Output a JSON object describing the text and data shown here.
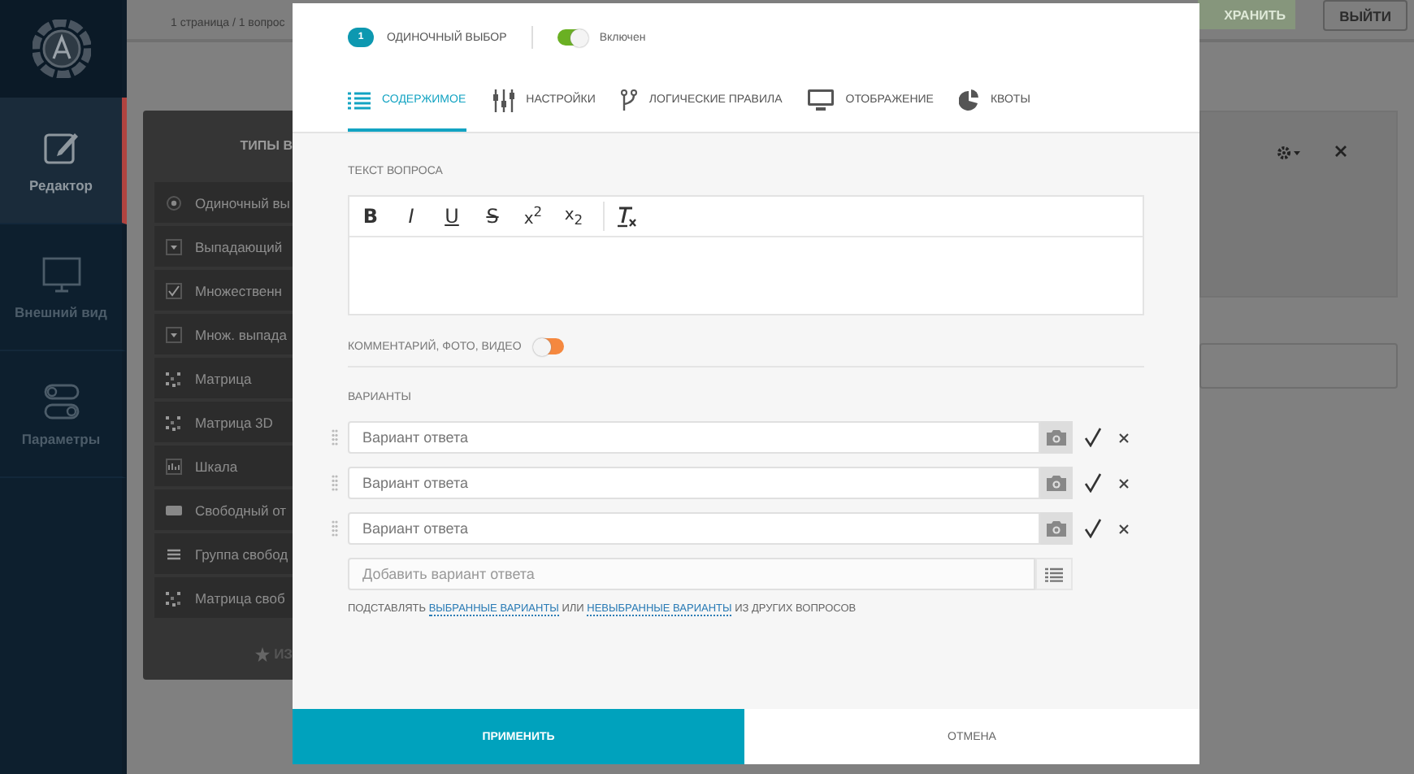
{
  "app_header": {
    "page_count": "1 страница / 1 вопрос",
    "save_button": "ХРАНИТЬ",
    "exit_button": "ВЫЙТИ"
  },
  "sidebar": {
    "items": [
      {
        "label": "Редактор",
        "kind": "edit",
        "selected": true
      },
      {
        "label": "Внешний вид",
        "kind": "monitor",
        "selected": false
      },
      {
        "label": "Параметры",
        "kind": "toggles",
        "selected": false
      }
    ]
  },
  "types_panel": {
    "title": "ТИПЫ В",
    "items": [
      {
        "label": "Одиночный вы",
        "kind": "radio"
      },
      {
        "label": "Выпадающий",
        "kind": "dropdown"
      },
      {
        "label": "Множественн",
        "kind": "checkbox"
      },
      {
        "label": "Множ. выпада",
        "kind": "dropdown"
      },
      {
        "label": "Матрица",
        "kind": "matrix"
      },
      {
        "label": "Матрица 3D",
        "kind": "matrix"
      },
      {
        "label": "Шкала",
        "kind": "scale"
      },
      {
        "label": "Свободный от",
        "kind": "textbox"
      },
      {
        "label": "Группа свобод",
        "kind": "lines"
      },
      {
        "label": "Матрица своб",
        "kind": "matrix"
      }
    ],
    "footer": "ИЗ"
  },
  "question_dialog": {
    "number": "1",
    "type": "ОДИНОЧНЫЙ ВЫБОР",
    "enabled": {
      "on": true,
      "label": "Включен"
    },
    "tabs": [
      {
        "label": "СОДЕРЖИМОЕ",
        "kind": "list",
        "selected": true
      },
      {
        "label": "НАСТРОЙКИ",
        "kind": "sliders",
        "selected": false
      },
      {
        "label": "ЛОГИЧЕСКИЕ ПРАВИЛА",
        "kind": "branch",
        "selected": false
      },
      {
        "label": "ОТОБРАЖЕНИЕ",
        "kind": "monitor",
        "selected": false
      },
      {
        "label": "КВОТЫ",
        "kind": "pie",
        "selected": false
      }
    ],
    "question_text": {
      "label": "ТЕКСТ ВОПРОСА",
      "toolbar": [
        {
          "kind": "bold",
          "glyph": "B"
        },
        {
          "kind": "italic",
          "glyph": "I"
        },
        {
          "kind": "underline",
          "glyph": "U"
        },
        {
          "kind": "strike",
          "glyph": "S"
        },
        {
          "kind": "superscript",
          "glyph": "x$^{2}$"
        },
        {
          "kind": "subscript",
          "glyph": "x$_{2}$"
        },
        {
          "kind": "clear"
        }
      ]
    },
    "comments": {
      "label": "КОММЕНТАРИЙ, ФОТО, ВИДЕО",
      "on": false
    },
    "options": {
      "label": "ВАРИАНТЫ",
      "items": [
        {
          "placeholder": "Вариант ответа"
        },
        {
          "placeholder": "Вариант ответа"
        },
        {
          "placeholder": "Вариант ответа"
        }
      ],
      "add_placeholder": "Добавить вариант ответа"
    },
    "substitute": [
      {
        "kind": "text",
        "text": "ПОДСТАВЛЯТЬ "
      },
      {
        "kind": "link",
        "text": "ВЫБРАННЫЕ ВАРИАНТЫ"
      },
      {
        "kind": "text",
        "text": " ИЛИ "
      },
      {
        "kind": "link",
        "text": "НЕВЫБРАННЫЕ ВАРИАНТЫ"
      },
      {
        "kind": "text",
        "text": " ИЗ ДРУГИХ ВОПРОСОВ"
      }
    ],
    "buttons": [
      {
        "label": "ПРИМЕНИТЬ",
        "kind": "primary"
      },
      {
        "label": "ОТМЕНА",
        "kind": "secondary"
      }
    ]
  }
}
